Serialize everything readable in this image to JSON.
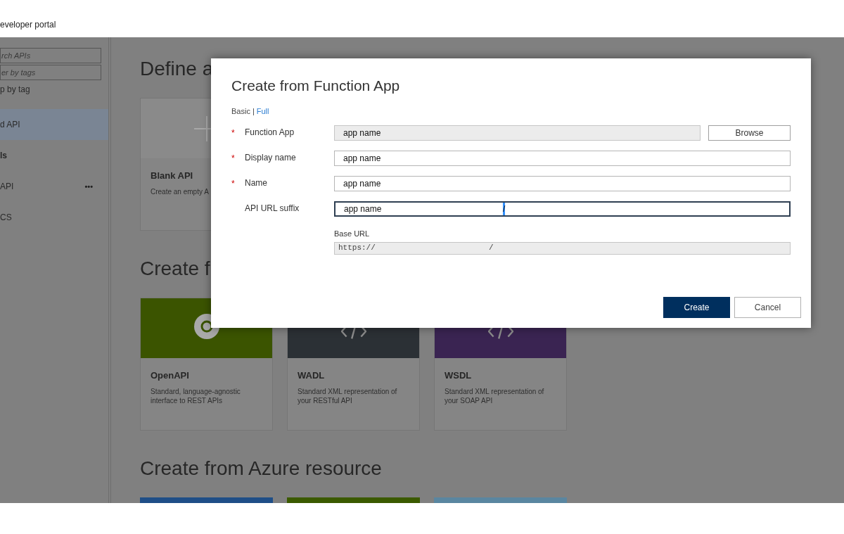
{
  "header": {
    "title": "eveloper portal"
  },
  "sidebar": {
    "search": {
      "placeholder": "rch APIs"
    },
    "tag_filter": {
      "placeholder": "er by tags"
    },
    "group_label": "p by tag",
    "items": [
      {
        "kind": "item",
        "label": "d API",
        "selected": true
      },
      {
        "kind": "header",
        "label": "ls",
        "selected": false
      },
      {
        "kind": "item",
        "label": "API",
        "selected": false,
        "menu": "•••"
      },
      {
        "kind": "item",
        "label": "CS",
        "selected": false
      }
    ]
  },
  "sections": [
    {
      "title": "Define a",
      "cards": [
        {
          "kind": "blank",
          "title": "Blank API",
          "description": "Create an empty A"
        }
      ]
    },
    {
      "title": "Create f",
      "cards": [
        {
          "kind": "openapi",
          "title": "OpenAPI",
          "description": "Standard, language-agnostic interface to REST APIs"
        },
        {
          "kind": "wadl",
          "title": "WADL",
          "description": "Standard XML representation of your RESTful API"
        },
        {
          "kind": "wsdl",
          "title": "WSDL",
          "description": "Standard XML representation of your SOAP API"
        }
      ]
    },
    {
      "title": "Create from Azure resource",
      "cards": [
        {
          "kind": "azure_blue"
        },
        {
          "kind": "azure_green"
        },
        {
          "kind": "azure_light"
        }
      ]
    }
  ],
  "dialog": {
    "title": "Create from Function App",
    "required_mark": "*",
    "modes": [
      {
        "label": "Basic",
        "selected": true
      },
      {
        "label": "Full",
        "selected": false
      }
    ],
    "mode_separator": "|",
    "fields": [
      {
        "label": "Function App",
        "required": true,
        "value": "app name",
        "disabled": true,
        "focused": false,
        "button": "Browse"
      },
      {
        "label": "Display name",
        "required": true,
        "value": "app name",
        "disabled": false,
        "focused": false
      },
      {
        "label": "Name",
        "required": true,
        "value": "app name",
        "disabled": false,
        "focused": false
      },
      {
        "label": "API URL suffix",
        "required": false,
        "value": "app name",
        "selected_text": "/",
        "disabled": false,
        "focused": true
      }
    ],
    "base_url": {
      "label": "Base URL",
      "parts": [
        "https://",
        "/"
      ]
    },
    "buttons": [
      {
        "label": "Create",
        "kind": "primary"
      },
      {
        "label": "Cancel",
        "kind": "secondary"
      }
    ]
  }
}
